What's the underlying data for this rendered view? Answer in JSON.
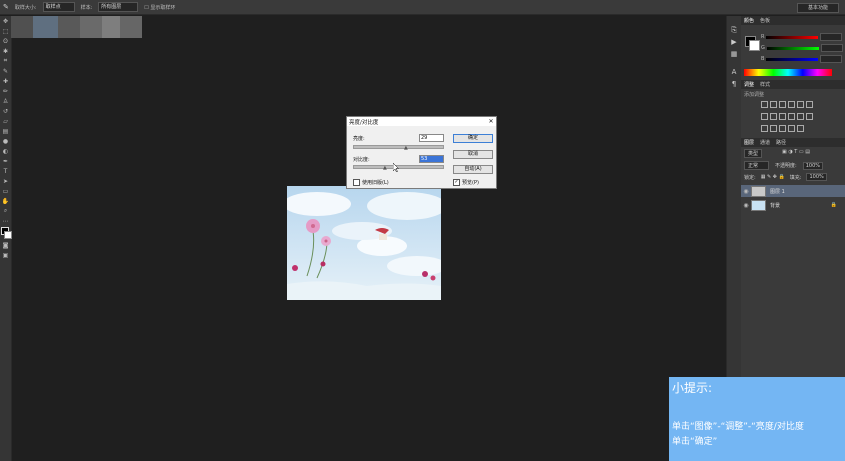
{
  "options_bar": {
    "tool_label": "取样大小:",
    "sample_value": "取样点",
    "sample_label": "样本:",
    "sample_scope": "所有图层",
    "show_ring_label": "显示取样环",
    "workspace": "基本功能"
  },
  "tabs_placeholder_colors": [
    "#505050",
    "#5f6f80",
    "#595959",
    "#6a6a6a",
    "#7e7e7e",
    "#666666"
  ],
  "panels": {
    "color_tabs": [
      "颜色",
      "色板"
    ],
    "color_channels": [
      "R",
      "G",
      "B"
    ],
    "adjust_tabs": [
      "调整",
      "样式"
    ],
    "adjust_hint": "添加调整",
    "layer_tabs": [
      "图层",
      "通道",
      "路径"
    ],
    "layer_kind": "类型",
    "blend_mode": "正常",
    "opacity_label": "不透明度:",
    "opacity_value": "100%",
    "lock_label": "锁定:",
    "fill_label": "填充:",
    "fill_value": "100%",
    "layers": [
      {
        "name": "图层 1",
        "selected": true
      },
      {
        "name": "背景",
        "selected": false
      }
    ]
  },
  "dialog": {
    "title": "亮度/对比度",
    "brightness_label": "亮度:",
    "brightness_value": "29",
    "contrast_label": "对比度:",
    "contrast_value": "53",
    "ok_label": "确定",
    "cancel_label": "取消",
    "auto_label": "自动(A)",
    "legacy_label": "使用旧版(L)",
    "legacy_checked": false,
    "preview_label": "预览(P)",
    "preview_checked": true
  },
  "tip": {
    "heading": "小提示:",
    "line1": "单击“图像”-“调整”-“亮度/对比度",
    "line2": "单击“确定”"
  },
  "colors": {
    "tip_bg": "#74b6f3",
    "selected_layer": "#59667a",
    "sky": "#c9e2f3"
  }
}
